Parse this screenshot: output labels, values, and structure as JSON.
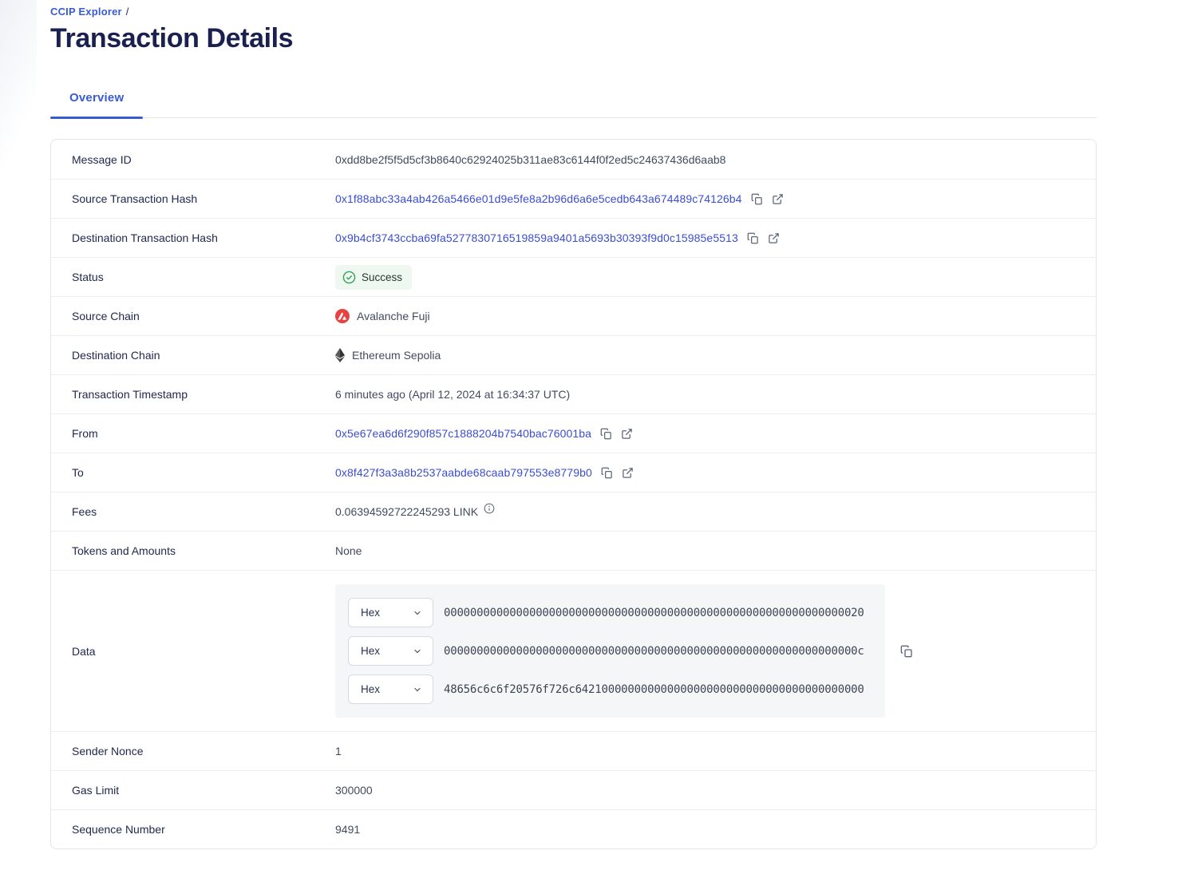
{
  "breadcrumb": {
    "link_label": "CCIP Explorer",
    "separator": "/"
  },
  "page": {
    "title": "Transaction Details"
  },
  "tabs": {
    "overview": {
      "label": "Overview",
      "active": true
    }
  },
  "colors": {
    "brand_blue": "#375bd2",
    "link_blue": "#3a4ed0",
    "title_navy": "#1a2150",
    "success_bg": "#eff7f1",
    "success_green": "#36a05c",
    "avalanche_red": "#e84142",
    "panel_gray": "#f5f6f8"
  },
  "rows": {
    "message_id": {
      "label": "Message ID",
      "value": "0xdd8be2f5f5d5cf3b8640c62924025b311ae83c6144f0f2ed5c24637436d6aab8"
    },
    "source_tx": {
      "label": "Source Transaction Hash",
      "value": "0x1f88abc33a4ab426a5466e01d9e5fe8a2b96d6a6e5cedb643a674489c74126b4"
    },
    "dest_tx": {
      "label": "Destination Transaction Hash",
      "value": "0x9b4cf3743ccba69fa5277830716519859a9401a5693b30393f9d0c15985e5513"
    },
    "status": {
      "label": "Status",
      "value": "Success"
    },
    "source_chain": {
      "label": "Source Chain",
      "value": "Avalanche Fuji",
      "icon": "avalanche-icon"
    },
    "dest_chain": {
      "label": "Destination Chain",
      "value": "Ethereum Sepolia",
      "icon": "ethereum-icon"
    },
    "timestamp": {
      "label": "Transaction Timestamp",
      "value": "6 minutes ago (April 12, 2024 at 16:34:37 UTC)"
    },
    "from": {
      "label": "From",
      "value": "0x5e67ea6d6f290f857c1888204b7540bac76001ba"
    },
    "to": {
      "label": "To",
      "value": "0x8f427f3a3a8b2537aabde68caab797553e8779b0"
    },
    "fees": {
      "label": "Fees",
      "value": "0.06394592722245293 LINK"
    },
    "tokens_and_amounts": {
      "label": "Tokens and Amounts",
      "value": "None"
    },
    "data": {
      "label": "Data",
      "format_selector": "Hex",
      "lines": [
        "0000000000000000000000000000000000000000000000000000000000000020",
        "000000000000000000000000000000000000000000000000000000000000000c",
        "48656c6c6f20576f726c64210000000000000000000000000000000000000000"
      ]
    },
    "sender_nonce": {
      "label": "Sender Nonce",
      "value": "1"
    },
    "gas_limit": {
      "label": "Gas Limit",
      "value": "300000"
    },
    "sequence_number": {
      "label": "Sequence Number",
      "value": "9491"
    }
  }
}
